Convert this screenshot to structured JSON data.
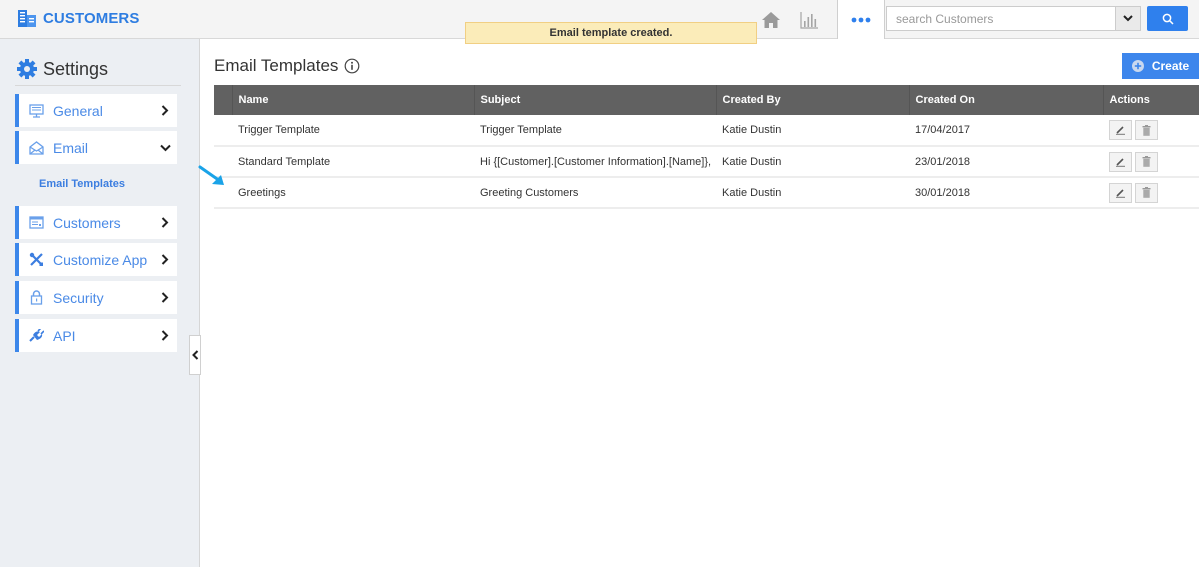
{
  "app": {
    "title": "CUSTOMERS",
    "colors": {
      "accent": "#2f80ed",
      "header_bg": "#616161",
      "toast_bg": "#fbecb9",
      "sidebar_bg": "#eceff3"
    }
  },
  "topbar": {
    "icons": [
      "home-icon",
      "chart-icon",
      "more-icon"
    ],
    "search": {
      "placeholder": "search Customers",
      "value": ""
    }
  },
  "toast": {
    "message": "Email template created."
  },
  "sidebar": {
    "title": "Settings",
    "items": [
      {
        "label": "General",
        "icon": "monitor-icon",
        "expanded": false
      },
      {
        "label": "Email",
        "icon": "envelope-icon",
        "expanded": true,
        "children": [
          {
            "label": "Email Templates",
            "active": true
          }
        ]
      },
      {
        "label": "Customers",
        "icon": "form-icon",
        "expanded": false
      },
      {
        "label": "Customize App",
        "icon": "tools-icon",
        "expanded": false
      },
      {
        "label": "Security",
        "icon": "lock-icon",
        "expanded": false
      },
      {
        "label": "API",
        "icon": "plug-icon",
        "expanded": false
      }
    ]
  },
  "main": {
    "title": "Email Templates",
    "create_label": "Create",
    "table": {
      "columns": [
        "Name",
        "Subject",
        "Created By",
        "Created On",
        "Actions"
      ],
      "rows": [
        {
          "name": "Trigger Template",
          "subject": "Trigger Template",
          "created_by": "Katie Dustin",
          "created_on": "17/04/2017"
        },
        {
          "name": "Standard Template",
          "subject": "Hi {[Customer].[Customer Information].[Name]},",
          "created_by": "Katie Dustin",
          "created_on": "23/01/2018"
        },
        {
          "name": "Greetings",
          "subject": "Greeting Customers",
          "created_by": "Katie Dustin",
          "created_on": "30/01/2018"
        }
      ]
    }
  }
}
